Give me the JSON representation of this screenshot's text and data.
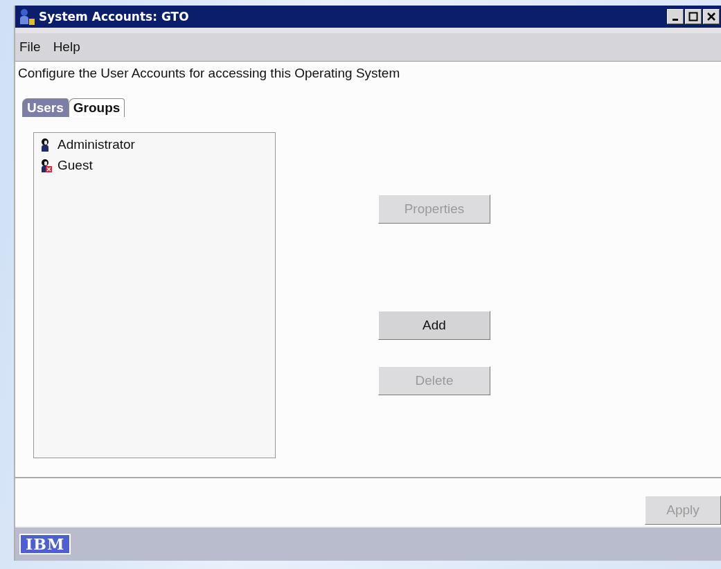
{
  "window": {
    "title": "System Accounts: GTO"
  },
  "menu": [
    "File",
    "Help"
  ],
  "description": "Configure the User Accounts for accessing this Operating System",
  "tabs": [
    {
      "label": "Users",
      "selected": true
    },
    {
      "label": "Groups",
      "selected": false
    }
  ],
  "accounts": [
    {
      "name": "Administrator",
      "disabled": false
    },
    {
      "name": "Guest",
      "disabled": true
    }
  ],
  "buttons": [
    {
      "label": "Properties",
      "disabled": true
    },
    {
      "label": "Add",
      "disabled": false
    },
    {
      "label": "Delete",
      "disabled": true
    }
  ],
  "apply": {
    "label": "Apply",
    "disabled": true
  },
  "logo": "IBM"
}
